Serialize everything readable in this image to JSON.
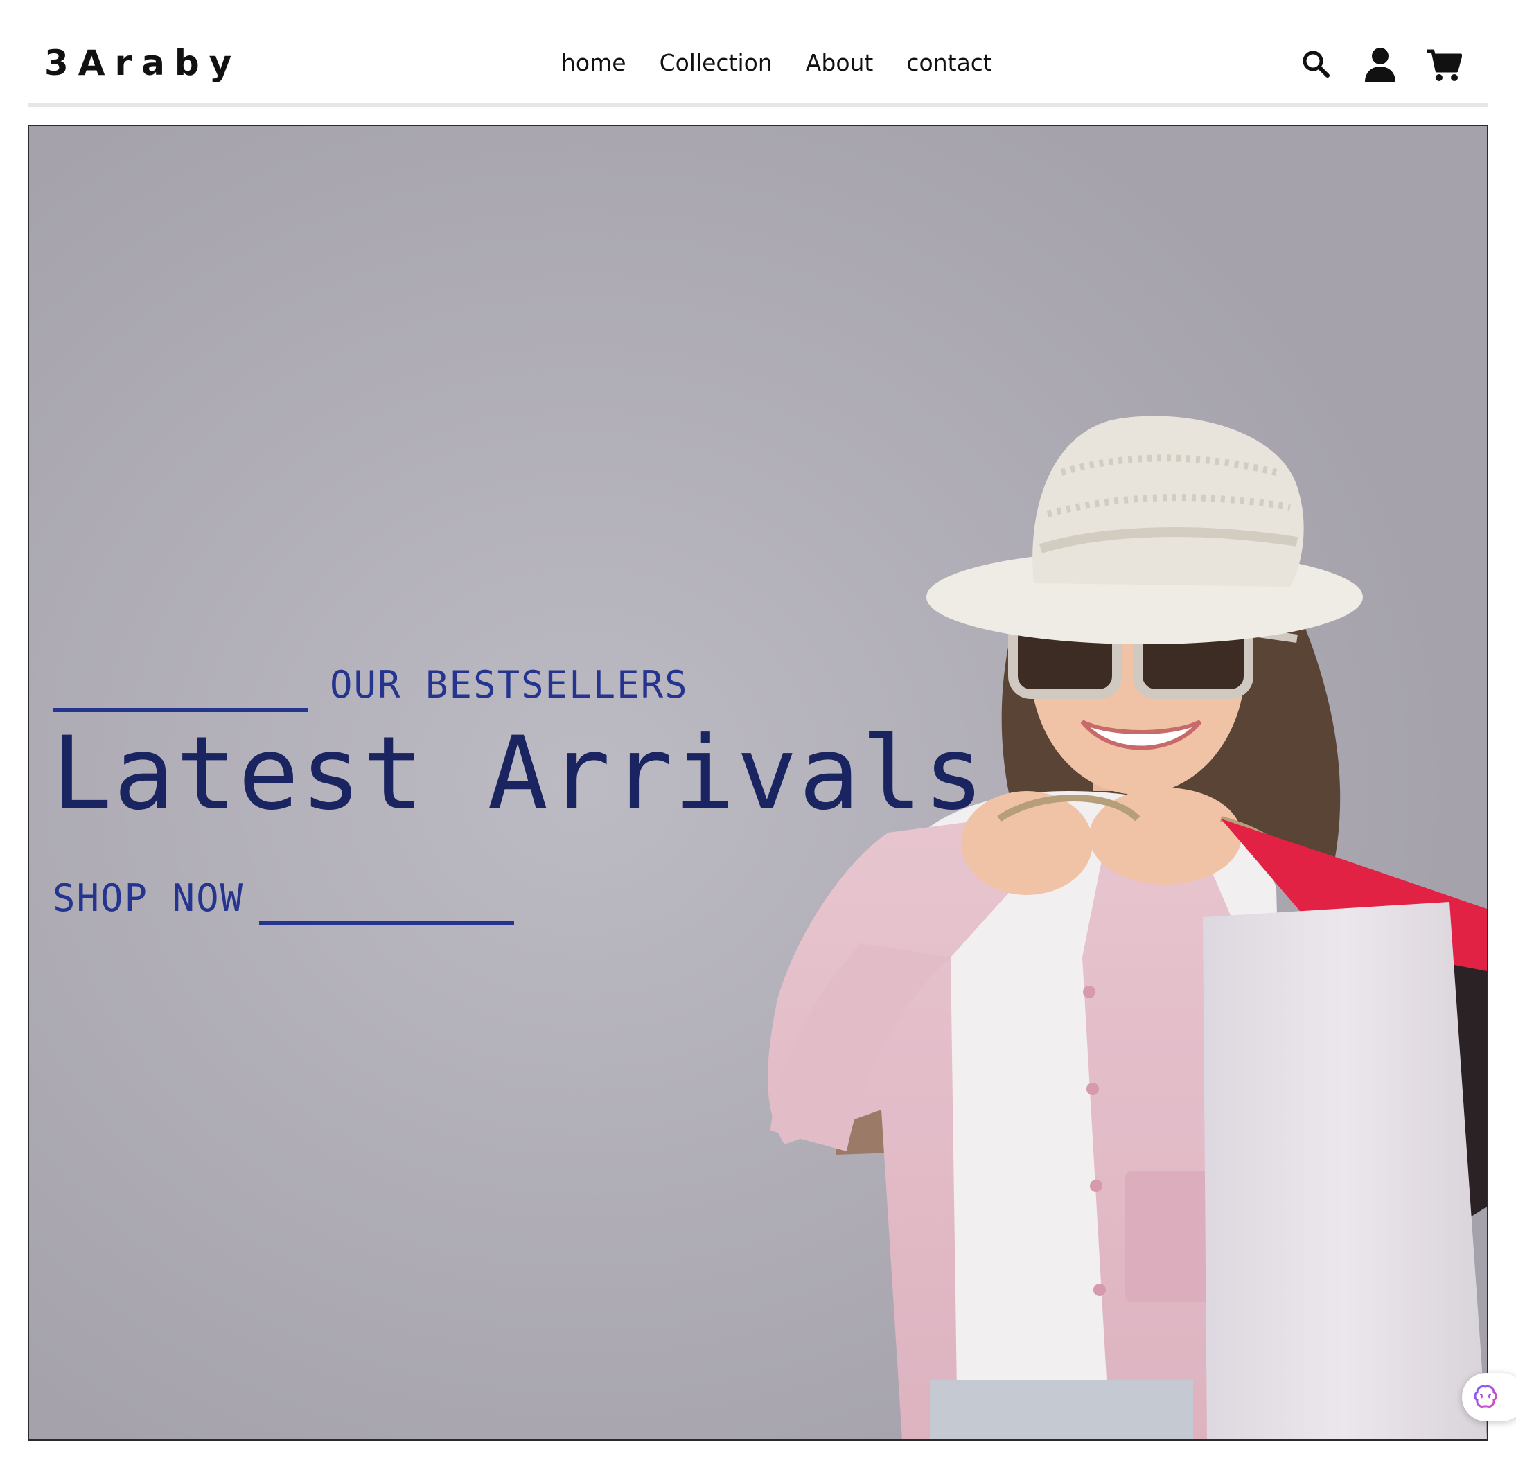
{
  "header": {
    "logo": "3Araby",
    "nav": [
      {
        "label": "home"
      },
      {
        "label": "Collection"
      },
      {
        "label": "About"
      },
      {
        "label": "contact"
      }
    ],
    "icons": [
      "search-icon",
      "user-icon",
      "cart-icon"
    ]
  },
  "hero": {
    "eyebrow": "OUR BESTSELLERS",
    "headline": "Latest Arrivals",
    "cta": "SHOP NOW",
    "accent_color": "#24348f",
    "headline_color": "#1a2460",
    "background_color": "#aeabb5"
  },
  "widget": {
    "icon": "brain-icon"
  }
}
